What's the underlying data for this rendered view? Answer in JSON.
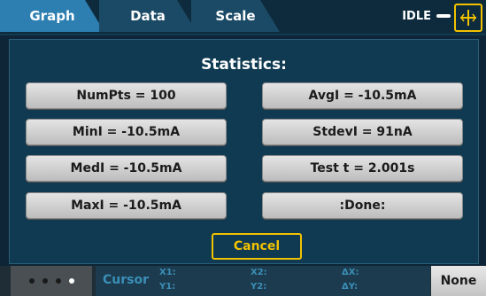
{
  "tabs": [
    {
      "label": "Graph"
    },
    {
      "label": "Data"
    },
    {
      "label": "Scale"
    }
  ],
  "status": {
    "text": "IDLE"
  },
  "dialog": {
    "title": "Statistics:",
    "buttons": [
      {
        "label": "NumPts = 100"
      },
      {
        "label": "AvgI = -10.5mA"
      },
      {
        "label": "MinI = -10.5mA"
      },
      {
        "label": "StdevI = 91nA"
      },
      {
        "label": "MedI = -10.5mA"
      },
      {
        "label": "Test t = 2.001s"
      },
      {
        "label": "MaxI = -10.5mA"
      },
      {
        "label": ":Done:"
      }
    ],
    "cancel_label": "Cancel"
  },
  "bottombar": {
    "cursor_label": "Cursor",
    "x1": "X1:",
    "y1": "Y1:",
    "x2": "X2:",
    "y2": "Y2:",
    "dx": "ΔX:",
    "dy": "ΔY:",
    "none_label": "None"
  },
  "colors": {
    "accent": "#f2c200",
    "active_tab": "#2c7fb0",
    "panel": "#0f3a52"
  }
}
